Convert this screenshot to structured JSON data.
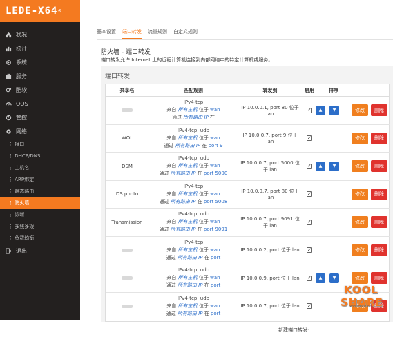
{
  "app_title": "LEDE-X64",
  "app_registered": "®",
  "sidebar": {
    "items": [
      {
        "label": "状况",
        "icon": "home-icon"
      },
      {
        "label": "统计",
        "icon": "bar-chart-icon"
      },
      {
        "label": "系统",
        "icon": "gear-icon"
      },
      {
        "label": "服务",
        "icon": "briefcase-icon"
      },
      {
        "label": "酷软",
        "icon": "gears-icon"
      },
      {
        "label": "QOS",
        "icon": "speedometer-icon"
      },
      {
        "label": "管控",
        "icon": "control-icon"
      },
      {
        "label": "网络",
        "icon": "cog-icon"
      }
    ],
    "network_items": [
      "接口",
      "DHCP/DNS",
      "主机名",
      "ARP绑定",
      "静态路由",
      "防火墙",
      "诊断",
      "多线多拨",
      "负载均衡"
    ],
    "logout": "退出"
  },
  "tabs": [
    "基本设置",
    "端口转发",
    "流量规则",
    "自定义规则"
  ],
  "active_tab": "端口转发",
  "page_title": "防火墙 - 端口转发",
  "page_desc": "端口转发允许 Internet 上的远程计算机连接到内部网络中的特定计算机或服务。",
  "section_title": "端口转发",
  "table": {
    "headers": [
      "共享名",
      "匹配规则",
      "转发到",
      "启用",
      "排序"
    ],
    "rows": [
      {
        "name": "",
        "proto": "IPv4-tcp",
        "from_text": "来自",
        "from_host": "所有主机",
        "from_pos": "位于",
        "from_zone": "wan",
        "via": "通过",
        "via_ip": "所有路由 IP",
        "via_pos": "在",
        "port": "",
        "fwd": "IP 10.0.0.1, port 80 位于 lan",
        "enabled": true,
        "has_order": true
      },
      {
        "name": "WOL",
        "proto": "IPv4-tcp, udp",
        "from_text": "来自",
        "from_host": "所有主机",
        "from_pos": "位于",
        "from_zone": "wan",
        "via": "通过",
        "via_ip": "所有路由 IP",
        "via_pos": "在",
        "port": "port 9",
        "fwd": "IP 10.0.0.7, port 9 位于 lan",
        "enabled": true,
        "has_order": false
      },
      {
        "name": "DSM",
        "proto": "IPv4-tcp, udp",
        "from_text": "来自",
        "from_host": "所有主机",
        "from_pos": "位于",
        "from_zone": "wan",
        "via": "通过",
        "via_ip": "所有路由 IP",
        "via_pos": "在",
        "port": "port 5000",
        "fwd": "IP 10.0.0.7, port 5000 位于 lan",
        "enabled": true,
        "has_order": true
      },
      {
        "name": "DS photo",
        "proto": "IPv4-tcp",
        "from_text": "来自",
        "from_host": "所有主机",
        "from_pos": "位于",
        "from_zone": "wan",
        "via": "通过",
        "via_ip": "所有路由 IP",
        "via_pos": "在",
        "port": "port 5008",
        "fwd": "IP 10.0.0.7, port 80 位于 lan",
        "enabled": true,
        "has_order": false
      },
      {
        "name": "Transmission",
        "proto": "IPv4-tcp, udp",
        "from_text": "来自",
        "from_host": "所有主机",
        "from_pos": "位于",
        "from_zone": "wan",
        "via": "通过",
        "via_ip": "所有路由 IP",
        "via_pos": "在",
        "port": "port 9091",
        "fwd": "IP 10.0.0.7, port 9091 位于 lan",
        "enabled": true,
        "has_order": false
      },
      {
        "name": "",
        "proto": "IPv4-tcp",
        "from_text": "来自",
        "from_host": "所有主机",
        "from_pos": "位于",
        "from_zone": "wan",
        "via": "通过",
        "via_ip": "所有路由 IP",
        "via_pos": "在",
        "port": "port",
        "fwd": "IP 10.0.0.2, port 位于 lan",
        "enabled": true,
        "has_order": false
      },
      {
        "name": "",
        "proto": "IPv4-tcp, udp",
        "from_text": "来自",
        "from_host": "所有主机",
        "from_pos": "位于",
        "from_zone": "wan",
        "via": "通过",
        "via_ip": "所有路由 IP",
        "via_pos": "在",
        "port": "port",
        "fwd": "IP 10.0.0.9, port 位于 lan",
        "enabled": true,
        "has_order": true
      },
      {
        "name": "",
        "proto": "IPv4-tcp, udp",
        "from_text": "来自",
        "from_host": "所有主机",
        "from_pos": "位于",
        "from_zone": "wan",
        "via": "通过",
        "via_ip": "所有路由 IP",
        "via_pos": "在",
        "port": "port",
        "fwd": "IP 10.0.0.7, port 位于 lan",
        "enabled": true,
        "has_order": false
      }
    ],
    "edit_label": "修改",
    "delete_label": "删除"
  },
  "footer_label": "新建端口转发:",
  "watermark": {
    "brand": "KOOL SHARE",
    "site": "koolshare.cn"
  },
  "colors": {
    "accent": "#f47a20",
    "blue": "#2c6ec9",
    "danger": "#e0332e",
    "sidebar": "#23201f"
  }
}
